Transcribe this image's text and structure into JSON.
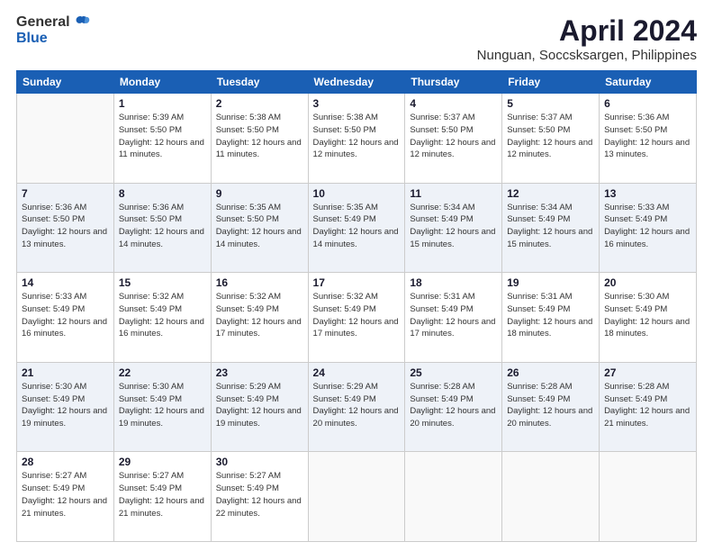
{
  "logo": {
    "general": "General",
    "blue": "Blue"
  },
  "header": {
    "month": "April 2024",
    "location": "Nunguan, Soccsksargen, Philippines"
  },
  "weekdays": [
    "Sunday",
    "Monday",
    "Tuesday",
    "Wednesday",
    "Thursday",
    "Friday",
    "Saturday"
  ],
  "weeks": [
    [
      {
        "day": "",
        "sunrise": "",
        "sunset": "",
        "daylight": ""
      },
      {
        "day": "1",
        "sunrise": "Sunrise: 5:39 AM",
        "sunset": "Sunset: 5:50 PM",
        "daylight": "Daylight: 12 hours and 11 minutes."
      },
      {
        "day": "2",
        "sunrise": "Sunrise: 5:38 AM",
        "sunset": "Sunset: 5:50 PM",
        "daylight": "Daylight: 12 hours and 11 minutes."
      },
      {
        "day": "3",
        "sunrise": "Sunrise: 5:38 AM",
        "sunset": "Sunset: 5:50 PM",
        "daylight": "Daylight: 12 hours and 12 minutes."
      },
      {
        "day": "4",
        "sunrise": "Sunrise: 5:37 AM",
        "sunset": "Sunset: 5:50 PM",
        "daylight": "Daylight: 12 hours and 12 minutes."
      },
      {
        "day": "5",
        "sunrise": "Sunrise: 5:37 AM",
        "sunset": "Sunset: 5:50 PM",
        "daylight": "Daylight: 12 hours and 12 minutes."
      },
      {
        "day": "6",
        "sunrise": "Sunrise: 5:36 AM",
        "sunset": "Sunset: 5:50 PM",
        "daylight": "Daylight: 12 hours and 13 minutes."
      }
    ],
    [
      {
        "day": "7",
        "sunrise": "Sunrise: 5:36 AM",
        "sunset": "Sunset: 5:50 PM",
        "daylight": "Daylight: 12 hours and 13 minutes."
      },
      {
        "day": "8",
        "sunrise": "Sunrise: 5:36 AM",
        "sunset": "Sunset: 5:50 PM",
        "daylight": "Daylight: 12 hours and 14 minutes."
      },
      {
        "day": "9",
        "sunrise": "Sunrise: 5:35 AM",
        "sunset": "Sunset: 5:50 PM",
        "daylight": "Daylight: 12 hours and 14 minutes."
      },
      {
        "day": "10",
        "sunrise": "Sunrise: 5:35 AM",
        "sunset": "Sunset: 5:49 PM",
        "daylight": "Daylight: 12 hours and 14 minutes."
      },
      {
        "day": "11",
        "sunrise": "Sunrise: 5:34 AM",
        "sunset": "Sunset: 5:49 PM",
        "daylight": "Daylight: 12 hours and 15 minutes."
      },
      {
        "day": "12",
        "sunrise": "Sunrise: 5:34 AM",
        "sunset": "Sunset: 5:49 PM",
        "daylight": "Daylight: 12 hours and 15 minutes."
      },
      {
        "day": "13",
        "sunrise": "Sunrise: 5:33 AM",
        "sunset": "Sunset: 5:49 PM",
        "daylight": "Daylight: 12 hours and 16 minutes."
      }
    ],
    [
      {
        "day": "14",
        "sunrise": "Sunrise: 5:33 AM",
        "sunset": "Sunset: 5:49 PM",
        "daylight": "Daylight: 12 hours and 16 minutes."
      },
      {
        "day": "15",
        "sunrise": "Sunrise: 5:32 AM",
        "sunset": "Sunset: 5:49 PM",
        "daylight": "Daylight: 12 hours and 16 minutes."
      },
      {
        "day": "16",
        "sunrise": "Sunrise: 5:32 AM",
        "sunset": "Sunset: 5:49 PM",
        "daylight": "Daylight: 12 hours and 17 minutes."
      },
      {
        "day": "17",
        "sunrise": "Sunrise: 5:32 AM",
        "sunset": "Sunset: 5:49 PM",
        "daylight": "Daylight: 12 hours and 17 minutes."
      },
      {
        "day": "18",
        "sunrise": "Sunrise: 5:31 AM",
        "sunset": "Sunset: 5:49 PM",
        "daylight": "Daylight: 12 hours and 17 minutes."
      },
      {
        "day": "19",
        "sunrise": "Sunrise: 5:31 AM",
        "sunset": "Sunset: 5:49 PM",
        "daylight": "Daylight: 12 hours and 18 minutes."
      },
      {
        "day": "20",
        "sunrise": "Sunrise: 5:30 AM",
        "sunset": "Sunset: 5:49 PM",
        "daylight": "Daylight: 12 hours and 18 minutes."
      }
    ],
    [
      {
        "day": "21",
        "sunrise": "Sunrise: 5:30 AM",
        "sunset": "Sunset: 5:49 PM",
        "daylight": "Daylight: 12 hours and 19 minutes."
      },
      {
        "day": "22",
        "sunrise": "Sunrise: 5:30 AM",
        "sunset": "Sunset: 5:49 PM",
        "daylight": "Daylight: 12 hours and 19 minutes."
      },
      {
        "day": "23",
        "sunrise": "Sunrise: 5:29 AM",
        "sunset": "Sunset: 5:49 PM",
        "daylight": "Daylight: 12 hours and 19 minutes."
      },
      {
        "day": "24",
        "sunrise": "Sunrise: 5:29 AM",
        "sunset": "Sunset: 5:49 PM",
        "daylight": "Daylight: 12 hours and 20 minutes."
      },
      {
        "day": "25",
        "sunrise": "Sunrise: 5:28 AM",
        "sunset": "Sunset: 5:49 PM",
        "daylight": "Daylight: 12 hours and 20 minutes."
      },
      {
        "day": "26",
        "sunrise": "Sunrise: 5:28 AM",
        "sunset": "Sunset: 5:49 PM",
        "daylight": "Daylight: 12 hours and 20 minutes."
      },
      {
        "day": "27",
        "sunrise": "Sunrise: 5:28 AM",
        "sunset": "Sunset: 5:49 PM",
        "daylight": "Daylight: 12 hours and 21 minutes."
      }
    ],
    [
      {
        "day": "28",
        "sunrise": "Sunrise: 5:27 AM",
        "sunset": "Sunset: 5:49 PM",
        "daylight": "Daylight: 12 hours and 21 minutes."
      },
      {
        "day": "29",
        "sunrise": "Sunrise: 5:27 AM",
        "sunset": "Sunset: 5:49 PM",
        "daylight": "Daylight: 12 hours and 21 minutes."
      },
      {
        "day": "30",
        "sunrise": "Sunrise: 5:27 AM",
        "sunset": "Sunset: 5:49 PM",
        "daylight": "Daylight: 12 hours and 22 minutes."
      },
      {
        "day": "",
        "sunrise": "",
        "sunset": "",
        "daylight": ""
      },
      {
        "day": "",
        "sunrise": "",
        "sunset": "",
        "daylight": ""
      },
      {
        "day": "",
        "sunrise": "",
        "sunset": "",
        "daylight": ""
      },
      {
        "day": "",
        "sunrise": "",
        "sunset": "",
        "daylight": ""
      }
    ]
  ]
}
